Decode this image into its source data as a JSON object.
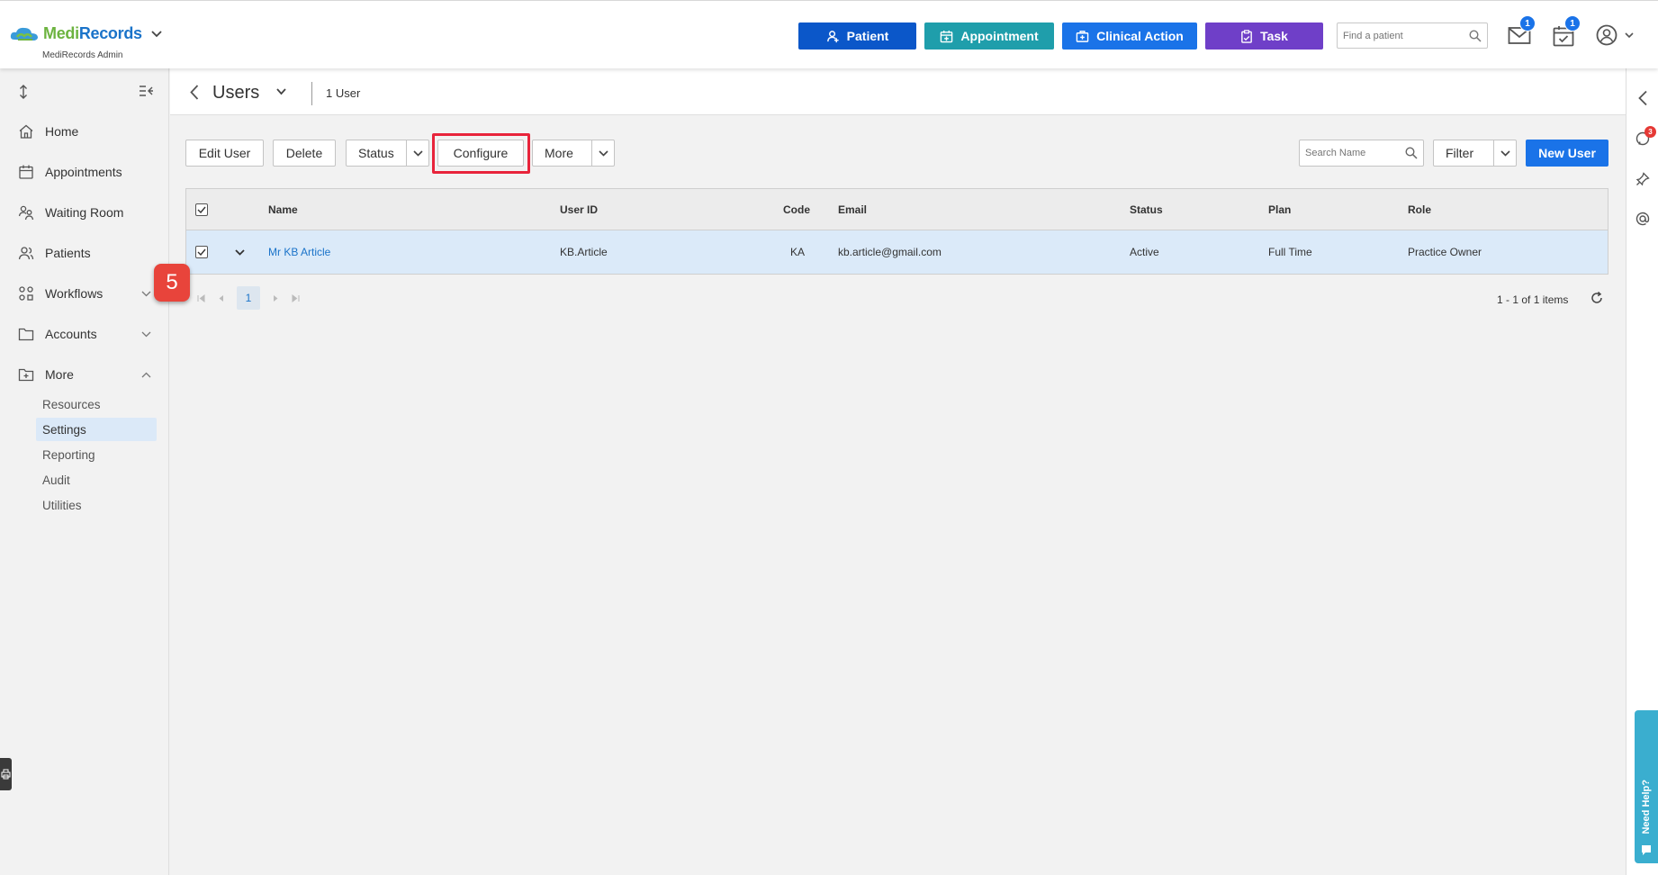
{
  "app": {
    "brand_medi": "Medi",
    "brand_records": "Records",
    "subtitle": "MediRecords Admin"
  },
  "topbar": {
    "buttons": [
      {
        "label": "Patient",
        "color": "#0b57c9"
      },
      {
        "label": "Appointment",
        "color": "#1f9eab"
      },
      {
        "label": "Clinical Action",
        "color": "#1a73e8"
      },
      {
        "label": "Task",
        "color": "#6f3fc8"
      }
    ],
    "search_placeholder": "Find a patient",
    "mail_badge": "1",
    "calendar_badge": "1"
  },
  "sidebar": {
    "items": [
      {
        "label": "Home"
      },
      {
        "label": "Appointments"
      },
      {
        "label": "Waiting Room"
      },
      {
        "label": "Patients"
      },
      {
        "label": "Workflows"
      },
      {
        "label": "Accounts"
      },
      {
        "label": "More"
      }
    ],
    "more_sub": [
      "Resources",
      "Settings",
      "Reporting",
      "Audit",
      "Utilities"
    ],
    "active_sub": "Settings"
  },
  "step_marker": "5",
  "page": {
    "title": "Users",
    "count": "1 User"
  },
  "toolbar": {
    "edit_user": "Edit User",
    "delete": "Delete",
    "status": "Status",
    "configure": "Configure",
    "more": "More",
    "search_placeholder": "Search Name",
    "filter": "Filter",
    "new_user": "New User"
  },
  "table": {
    "columns": [
      "Name",
      "User ID",
      "Code",
      "Email",
      "Status",
      "Plan",
      "Role"
    ],
    "rows": [
      {
        "name": "Mr KB Article",
        "user_id": "KB.Article",
        "code": "KA",
        "email": "kb.article@gmail.com",
        "status": "Active",
        "plan": "Full Time",
        "role": "Practice Owner"
      }
    ]
  },
  "pagination": {
    "current_page": "1",
    "summary": "1 - 1 of 1 items"
  },
  "right_rail": {
    "notification_badge": "3",
    "help_label": "Need Help?"
  }
}
